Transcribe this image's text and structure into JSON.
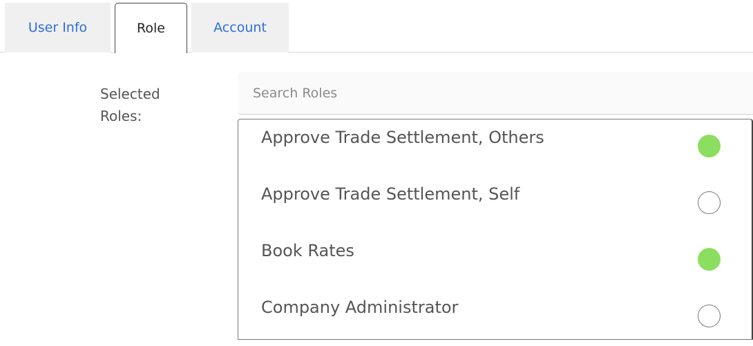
{
  "tabs": [
    {
      "label": "User Info",
      "active": false
    },
    {
      "label": "Role",
      "active": true
    },
    {
      "label": "Account",
      "active": false
    }
  ],
  "form": {
    "label": "Selected\nRoles:",
    "search_placeholder": "Search Roles",
    "search_value": ""
  },
  "roles": [
    {
      "label": "Approve Trade Settlement, Others",
      "selected": true
    },
    {
      "label": "Approve Trade Settlement, Self",
      "selected": false
    },
    {
      "label": "Book Rates",
      "selected": true
    },
    {
      "label": "Company Administrator",
      "selected": false
    }
  ],
  "colors": {
    "selected_indicator": "#8bde5f",
    "tab_link": "#2d6fd6",
    "tab_bg": "#f0f0f0"
  }
}
